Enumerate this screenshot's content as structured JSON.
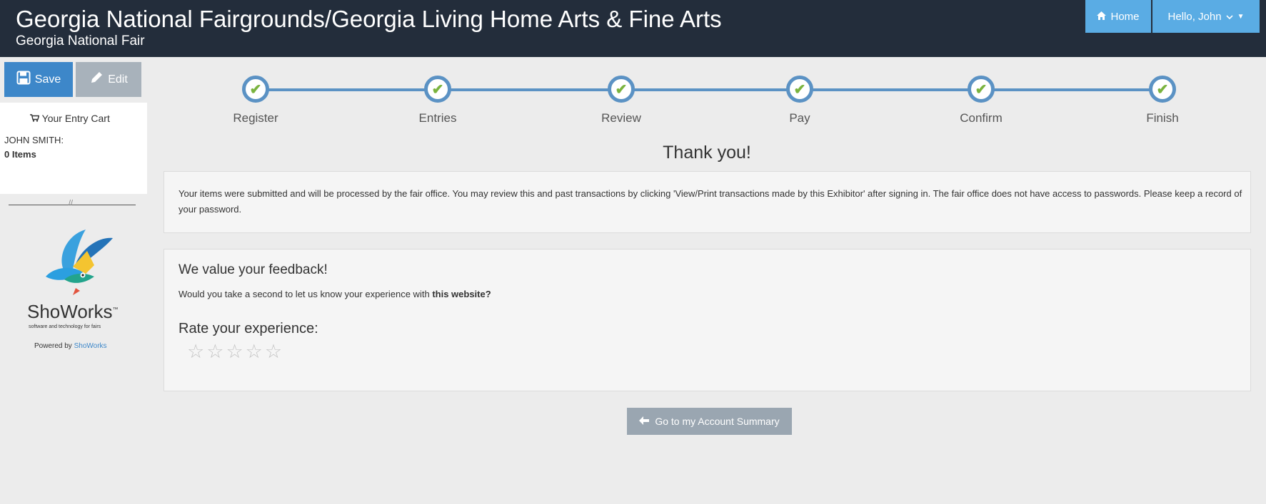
{
  "header": {
    "title": "Georgia National Fairgrounds/Georgia Living Home Arts & Fine Arts",
    "subtitle": "Georgia National Fair",
    "home_label": "Home",
    "user_label": "Hello, John"
  },
  "sidebar": {
    "save_label": "Save",
    "edit_label": "Edit",
    "cart_title": "Your Entry Cart",
    "cart_name": "JOHN SMITH:",
    "cart_items": "0 Items",
    "brand": "ShoWorks",
    "brand_tm": "™",
    "tagline": "software and technology for fairs",
    "powered_prefix": "Powered by",
    "powered_link": "ShoWorks"
  },
  "steps": [
    {
      "label": "Register",
      "complete": true
    },
    {
      "label": "Entries",
      "complete": true
    },
    {
      "label": "Review",
      "complete": true
    },
    {
      "label": "Pay",
      "complete": true
    },
    {
      "label": "Confirm",
      "complete": true
    },
    {
      "label": "Finish",
      "complete": true
    }
  ],
  "main": {
    "thank_you": "Thank you!",
    "notice": "Your items were submitted and will be processed by the fair office. You may review this and past transactions by clicking  'View/Print transactions made by this Exhibitor' after signing in. The fair office does not have access to passwords. Please keep a record of your password.",
    "feedback_heading": "We value your feedback!",
    "feedback_question": "Would you take a second to let us know your experience with",
    "feedback_target": "this website?",
    "rate_label": "Rate your experience:",
    "rating": 0,
    "rating_max": 5,
    "account_button": "Go to my Account Summary"
  },
  "colors": {
    "header_bg": "#232d3b",
    "nav_button": "#5aace4",
    "save_button": "#3d87c9",
    "step_ring": "#5b92c4",
    "check": "#7ab33e"
  }
}
